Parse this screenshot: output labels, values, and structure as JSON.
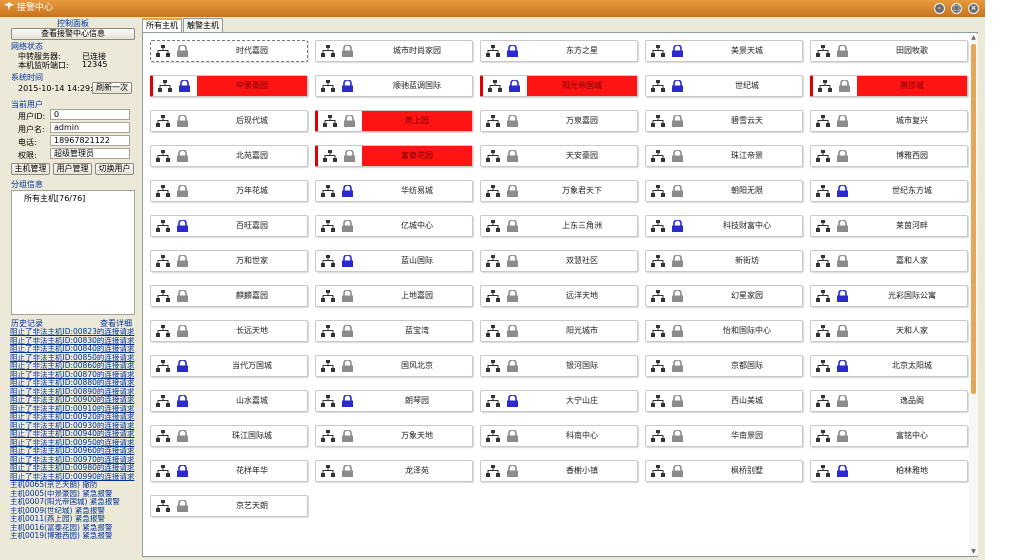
{
  "window": {
    "title": "接警中心"
  },
  "sidebar": {
    "panel_title": "控制面板",
    "view_center_button": "查看接警中心信息",
    "network": {
      "section_title": "网络状态",
      "server_label": "中转服务器:",
      "server_value": "已连接",
      "port_label": "本机监听端口:",
      "port_value": "12345"
    },
    "time": {
      "section_title": "系统时间",
      "value": "2015-10-14 14:29:13",
      "sync_button": "刷新一次"
    },
    "user": {
      "section_title": "当前用户",
      "id_label": "用户ID:",
      "id_value": "0",
      "name_label": "用户名:",
      "name_value": "admin",
      "phone_label": "电话:",
      "phone_value": "18967821122",
      "role_label": "权限:",
      "role_value": "超级管理员"
    },
    "actions": {
      "host_manage": "主机管理",
      "user_manage": "用户管理",
      "switch_user": "切换用户"
    },
    "group": {
      "section_title": "分组信息",
      "item": "所有主机[76/76]"
    },
    "history": {
      "section_title": "历史记录",
      "detail_link": "查看详细",
      "lines": [
        "阻止了非法主机ID:00823的连接请求",
        "阻止了非法主机ID:00830的连接请求",
        "阻止了非法主机ID:00840的连接请求",
        "阻止了非法主机ID:00850的连接请求",
        "阻止了非法主机ID:00860的连接请求",
        "阻止了非法主机ID:00870的连接请求",
        "阻止了非法主机ID:00880的连接请求",
        "阻止了非法主机ID:00890的连接请求",
        "阻止了非法主机ID:00900的连接请求",
        "阻止了非法主机ID:00910的连接请求",
        "阻止了非法主机ID:00920的连接请求",
        "阻止了非法主机ID:00930的连接请求",
        "阻止了非法主机ID:00940的连接请求",
        "阻止了非法主机ID:00950的连接请求",
        "阻止了非法主机ID:00960的连接请求",
        "阻止了非法主机ID:00970的连接请求",
        "阻止了非法主机ID:00980的连接请求",
        "阻止了非法主机ID:00990的连接请求",
        "主机0065(京艺天朗) 撤防",
        "主机0005(中景豪园) 紧急报警",
        "主机0007(阳光帝国城) 紧急报警",
        "主机0009(世纪城) 紧急报警",
        "主机0011(燕上园) 紧急报警",
        "主机0016(富泰花园) 紧急报警",
        "主机0019(博雅西园) 紧急报警"
      ]
    }
  },
  "tabs": [
    "所有主机",
    "触警主机"
  ],
  "hosts": [
    {
      "name": "时代嘉园",
      "lock": "gray",
      "alarm": false,
      "selected": true
    },
    {
      "name": "城市时尚家园",
      "lock": "gray",
      "alarm": false
    },
    {
      "name": "东方之星",
      "lock": "blue",
      "alarm": false
    },
    {
      "name": "美景天城",
      "lock": "blue",
      "alarm": false
    },
    {
      "name": "田园牧歌",
      "lock": "gray",
      "alarm": false
    },
    {
      "name": "中景豪园",
      "lock": "blue",
      "alarm": true
    },
    {
      "name": "顺驰蓝调国际",
      "lock": "blue",
      "alarm": false
    },
    {
      "name": "阳光帝国城",
      "lock": "blue",
      "alarm": true
    },
    {
      "name": "世纪城",
      "lock": "blue",
      "alarm": false
    },
    {
      "name": "燕莎城",
      "lock": "gray",
      "alarm": true
    },
    {
      "name": "后现代城",
      "lock": "gray",
      "alarm": false
    },
    {
      "name": "燕上园",
      "lock": "gray",
      "alarm": true
    },
    {
      "name": "万泉嘉园",
      "lock": "gray",
      "alarm": false
    },
    {
      "name": "碧雪云天",
      "lock": "gray",
      "alarm": false
    },
    {
      "name": "城市复兴",
      "lock": "gray",
      "alarm": false
    },
    {
      "name": "北苑嘉园",
      "lock": "gray",
      "alarm": false
    },
    {
      "name": "富泰花园",
      "lock": "gray",
      "alarm": true
    },
    {
      "name": "天安豪园",
      "lock": "gray",
      "alarm": false
    },
    {
      "name": "珠江帝景",
      "lock": "gray",
      "alarm": false
    },
    {
      "name": "博雅西园",
      "lock": "gray",
      "alarm": false
    },
    {
      "name": "万年花城",
      "lock": "gray",
      "alarm": false
    },
    {
      "name": "华纺易城",
      "lock": "blue",
      "alarm": false
    },
    {
      "name": "万象君天下",
      "lock": "gray",
      "alarm": false
    },
    {
      "name": "朝阳无限",
      "lock": "gray",
      "alarm": false
    },
    {
      "name": "世纪东方城",
      "lock": "blue",
      "alarm": false
    },
    {
      "name": "百旺嘉园",
      "lock": "blue",
      "alarm": false
    },
    {
      "name": "亿城中心",
      "lock": "gray",
      "alarm": false
    },
    {
      "name": "上东三角洲",
      "lock": "gray",
      "alarm": false
    },
    {
      "name": "科技财富中心",
      "lock": "blue",
      "alarm": false
    },
    {
      "name": "莱茵河畔",
      "lock": "gray",
      "alarm": false
    },
    {
      "name": "万和世家",
      "lock": "gray",
      "alarm": false
    },
    {
      "name": "蓝山国际",
      "lock": "blue",
      "alarm": false
    },
    {
      "name": "双慧社区",
      "lock": "gray",
      "alarm": false
    },
    {
      "name": "新街坊",
      "lock": "gray",
      "alarm": false
    },
    {
      "name": "嘉和人家",
      "lock": "gray",
      "alarm": false
    },
    {
      "name": "麒麟嘉园",
      "lock": "gray",
      "alarm": false
    },
    {
      "name": "上地嘉园",
      "lock": "gray",
      "alarm": false
    },
    {
      "name": "远洋天地",
      "lock": "gray",
      "alarm": false
    },
    {
      "name": "幻星家园",
      "lock": "gray",
      "alarm": false
    },
    {
      "name": "光彩国际公寓",
      "lock": "blue",
      "alarm": false
    },
    {
      "name": "长远天地",
      "lock": "gray",
      "alarm": false
    },
    {
      "name": "蓝宝湾",
      "lock": "gray",
      "alarm": false
    },
    {
      "name": "阳光城市",
      "lock": "gray",
      "alarm": false
    },
    {
      "name": "怡和国际中心",
      "lock": "gray",
      "alarm": false
    },
    {
      "name": "天和人家",
      "lock": "gray",
      "alarm": false
    },
    {
      "name": "当代万国城",
      "lock": "blue",
      "alarm": false
    },
    {
      "name": "国风北京",
      "lock": "gray",
      "alarm": false
    },
    {
      "name": "银河国际",
      "lock": "gray",
      "alarm": false
    },
    {
      "name": "京都国际",
      "lock": "gray",
      "alarm": false
    },
    {
      "name": "北京太阳城",
      "lock": "blue",
      "alarm": false
    },
    {
      "name": "山水嘉城",
      "lock": "blue",
      "alarm": false
    },
    {
      "name": "朗琴园",
      "lock": "blue",
      "alarm": false
    },
    {
      "name": "大宁山庄",
      "lock": "blue",
      "alarm": false
    },
    {
      "name": "西山美城",
      "lock": "gray",
      "alarm": false
    },
    {
      "name": "逸品阁",
      "lock": "gray",
      "alarm": false
    },
    {
      "name": "珠江国际城",
      "lock": "gray",
      "alarm": false
    },
    {
      "name": "万象天地",
      "lock": "gray",
      "alarm": false
    },
    {
      "name": "科南中心",
      "lock": "gray",
      "alarm": false
    },
    {
      "name": "华南景园",
      "lock": "gray",
      "alarm": false
    },
    {
      "name": "富铭中心",
      "lock": "gray",
      "alarm": false
    },
    {
      "name": "花样年华",
      "lock": "blue",
      "alarm": false
    },
    {
      "name": "龙泽苑",
      "lock": "gray",
      "alarm": false
    },
    {
      "name": "香榭小镇",
      "lock": "gray",
      "alarm": false
    },
    {
      "name": "枫桥别墅",
      "lock": "gray",
      "alarm": false
    },
    {
      "name": "柏林雅地",
      "lock": "blue",
      "alarm": false
    },
    {
      "name": "京艺天朗",
      "lock": "gray",
      "alarm": false
    }
  ],
  "colors": {
    "alarm": "#ff1414",
    "lock_blue": "#2a2acf",
    "lock_gray": "#8c8c8c",
    "titlebar": "#d9852a"
  }
}
